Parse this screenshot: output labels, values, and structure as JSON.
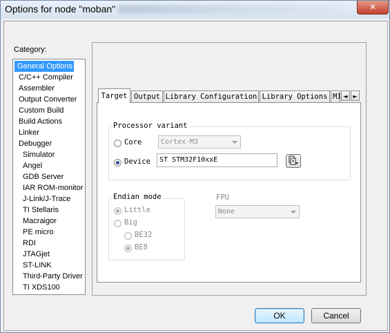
{
  "window": {
    "title": "Options for node \"moban\"",
    "close_glyph": "✕"
  },
  "category": {
    "label": "Category:",
    "items": [
      {
        "label": "General Options",
        "selected": true
      },
      {
        "label": "C/C++ Compiler"
      },
      {
        "label": "Assembler"
      },
      {
        "label": "Output Converter"
      },
      {
        "label": "Custom Build"
      },
      {
        "label": "Build Actions"
      },
      {
        "label": "Linker"
      },
      {
        "label": "Debugger"
      },
      {
        "label": "Simulator"
      },
      {
        "label": "Angel"
      },
      {
        "label": "GDB Server"
      },
      {
        "label": "IAR ROM-monitor"
      },
      {
        "label": "J-Link/J-Trace"
      },
      {
        "label": "TI Stellaris"
      },
      {
        "label": "Macraigor"
      },
      {
        "label": "PE micro"
      },
      {
        "label": "RDI"
      },
      {
        "label": "JTAGjet"
      },
      {
        "label": "ST-LINK"
      },
      {
        "label": "Third-Party Driver"
      },
      {
        "label": "TI XDS100"
      }
    ]
  },
  "tabs": [
    {
      "label": "Target",
      "active": true
    },
    {
      "label": "Output"
    },
    {
      "label": "Library Configuration"
    },
    {
      "label": "Library Options"
    },
    {
      "label": "MI"
    }
  ],
  "tab_scroll": {
    "left": "◄",
    "right": "►"
  },
  "processor_variant": {
    "title": "Processor variant",
    "core_label": "Core",
    "core_value": "Cortex-M3",
    "device_label": "Device",
    "device_value": "ST STM32F10xxE",
    "selected": "device"
  },
  "endian_mode": {
    "title": "Endian mode",
    "little_label": "Little",
    "big_label": "Big",
    "be32_label": "BE32",
    "be8_label": "BE8",
    "selected": "little",
    "big_selected": "be8"
  },
  "fpu": {
    "label": "FPU",
    "value": "None"
  },
  "buttons": {
    "ok": "OK",
    "cancel": "Cancel"
  }
}
